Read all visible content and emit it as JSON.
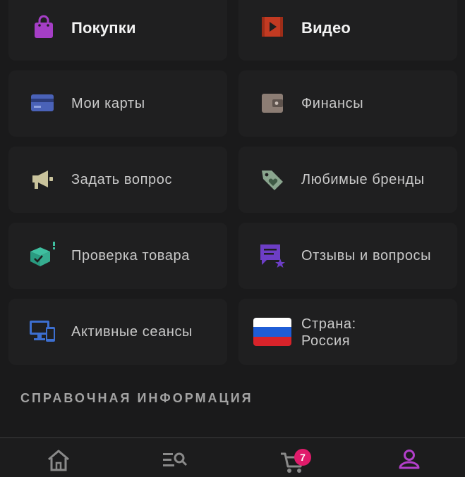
{
  "menu": {
    "items": [
      {
        "label": "Покупки",
        "icon": "shopping-bag-icon"
      },
      {
        "label": "Видео",
        "icon": "video-play-icon"
      },
      {
        "label": "Мои карты",
        "icon": "credit-card-icon"
      },
      {
        "label": "Финансы",
        "icon": "wallet-icon"
      },
      {
        "label": "Задать вопрос",
        "icon": "megaphone-icon"
      },
      {
        "label": "Любимые бренды",
        "icon": "price-tag-heart-icon"
      },
      {
        "label": "Проверка товара",
        "icon": "box-check-icon"
      },
      {
        "label": "Отзывы и вопросы",
        "icon": "review-star-icon"
      },
      {
        "label": "Активные сеансы",
        "icon": "devices-icon"
      },
      {
        "label_line1": "Страна:",
        "label_line2": "Россия",
        "icon": "russia-flag-icon"
      }
    ]
  },
  "section": {
    "title": "СПРАВОЧНАЯ ИНФОРМАЦИЯ"
  },
  "bottom_nav": {
    "items": [
      {
        "name": "home",
        "icon": "home-icon"
      },
      {
        "name": "catalog",
        "icon": "catalog-search-icon"
      },
      {
        "name": "cart",
        "icon": "cart-icon",
        "badge": "7"
      },
      {
        "name": "profile",
        "icon": "profile-icon"
      }
    ]
  },
  "colors": {
    "background": "#1a1a1b",
    "tile": "#1f1f20",
    "accent_purple": "#a53ec6",
    "badge": "#e01b6b"
  }
}
